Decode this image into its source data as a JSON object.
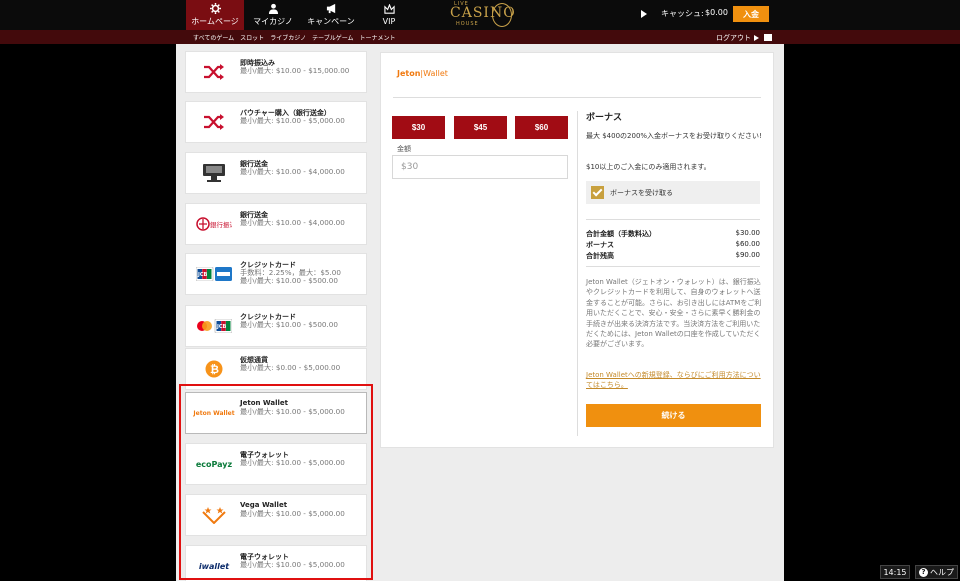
{
  "nav": {
    "items": [
      {
        "label": "ホームページ",
        "icon": "gear-icon"
      },
      {
        "label": "マイカジノ",
        "icon": "user-icon"
      },
      {
        "label": "キャンペーン",
        "icon": "megaphone-icon"
      },
      {
        "label": "VIP",
        "icon": "crown-icon"
      }
    ]
  },
  "logo": {
    "line1": "LIVE",
    "line2": "CASINO",
    "line3": "HOUSE"
  },
  "account": {
    "cash_label": "キャッシュ:",
    "cash_value": "$0.00",
    "deposit_label": "入金"
  },
  "subnav": {
    "items": [
      "すべてのゲーム",
      "スロット",
      "ライブカジノ",
      "テーブルゲーム",
      "トーナメント"
    ],
    "logout_label": "ログアウト"
  },
  "payment_methods": [
    {
      "title": "即時振込み",
      "sub": "最小/最大: $10.00 - $15,000.00",
      "icon": "shuffle-icon"
    },
    {
      "title": "バウチャー購入（銀行送金）",
      "sub": "最小/最大: $10.00 - $5,000.00",
      "icon": "shuffle-icon"
    },
    {
      "title": "銀行送金",
      "sub": "最小/最大: $10.00 - $4,000.00",
      "icon": "bank-atm-icon"
    },
    {
      "title": "銀行送金",
      "sub": "最小/最大: $10.00 - $4,000.00",
      "icon": "bank-transfer-icon",
      "icon_text": "銀行振込"
    },
    {
      "title": "クレジットカード",
      "sub": "手数料：2.25%，最大：$5.00 最小/最大: $10.00 - $500.00",
      "icon": "jcb-amex-icon",
      "icon_text": "JCB"
    },
    {
      "title": "クレジットカード",
      "sub": "最小/最大: $10.00 - $500.00",
      "icon": "mastercard-jcb-icon",
      "icon_text": "JCB"
    },
    {
      "title": "仮想通貨",
      "sub": "最小/最大: $0.00 - $5,000.00",
      "icon": "bitcoin-icon",
      "icon_text": "₿"
    },
    {
      "title": "Jeton Wallet",
      "sub": "最小/最大: $10.00 - $5,000.00",
      "icon": "jeton-wallet-logo",
      "icon_text": "Jeton Wallet"
    },
    {
      "title": "電子ウォレット",
      "sub": "最小/最大: $10.00 - $5,000.00",
      "icon": "ecopayz-logo",
      "icon_text": "ecoPayz"
    },
    {
      "title": "Vega Wallet",
      "sub": "最小/最大: $10.00 - $5,000.00",
      "icon": "vega-wallet-logo"
    },
    {
      "title": "電子ウォレット",
      "sub": "最小/最大: $10.00 - $5,000.00",
      "icon": "iwallet-logo",
      "icon_text": "iwallet"
    }
  ],
  "selected_method": "Jeton Wallet",
  "panel": {
    "logo_jeton": "Jeton",
    "logo_sep": "|",
    "logo_wallet": "Wallet",
    "amount_buttons": [
      "$30",
      "$45",
      "$60"
    ],
    "amount_label": "金額",
    "amount_value": "$30"
  },
  "bonus": {
    "title": "ボーナス",
    "description": "最大 $400の200%入金ボーナスをお受け取りください!",
    "note": "$10以上のご入金にのみ適用されます。",
    "checkbox_label": "ボーナスを受け取る",
    "checked": true
  },
  "summary": [
    {
      "label": "合計金額（手数料込）",
      "value": "$30.00"
    },
    {
      "label": "ボーナス",
      "value": "$60.00"
    },
    {
      "label": "合計残高",
      "value": "$90.00"
    }
  ],
  "info": {
    "text": "Jeton Wallet（ジェトオン・ウォレット）は、銀行振込やクレジットカードを利用して、自身のウォレットへ送金することが可能。さらに、お引き出しにはATMをご利用いただくことで、安心・安全・さらに素早く勝利金の手続きが出来る決済方法です。当決済方法をご利用いただくためには、Jeton Walletの口座を作成していただく必要がございます。",
    "link": "Jeton Walletへの新規登録、ならびにご利用方法についてはこちら。"
  },
  "continue_label": "続ける",
  "footer": {
    "time": "14:15",
    "help_label": "ヘルプ"
  },
  "colors": {
    "accent": "#f0900f",
    "brand_red": "#a10c14",
    "highlight": "#e01010",
    "gold": "#c8a03e"
  }
}
